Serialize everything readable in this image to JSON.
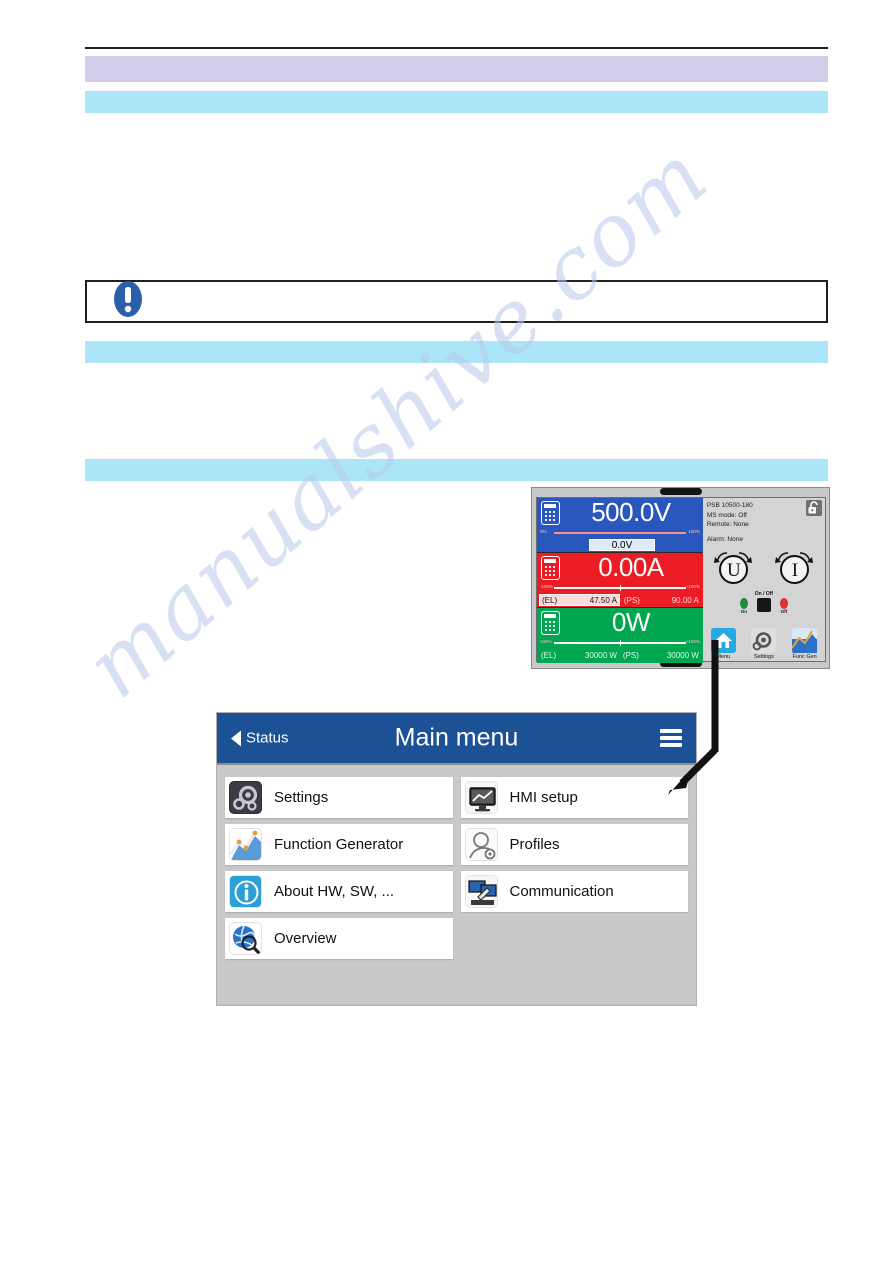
{
  "document": {
    "watermark": "manualshive.com"
  },
  "note": {
    "icon": "info-exclamation-icon",
    "text": ""
  },
  "device_display": {
    "voltage": {
      "icon": "keypad-icon",
      "value": "500.0V",
      "setpoint": "0.0V",
      "scale_min": "0%",
      "scale_max": "100%",
      "color": "#2a57bd"
    },
    "current": {
      "icon": "keypad-icon",
      "value": "0.00A",
      "scale_min": "-100%",
      "scale_max": "+100%",
      "el_label": "(EL)",
      "el_value": "47.50 A",
      "ps_label": "(PS)",
      "ps_value": "90.00 A",
      "color": "#ec1c24"
    },
    "power": {
      "icon": "keypad-icon",
      "value": "0W",
      "scale_min": "100%",
      "scale_max": "+100%",
      "el_label": "(EL)",
      "el_value": "30000 W",
      "ps_label": "(PS)",
      "ps_value": "30000 W",
      "color": "#00a650"
    },
    "status": {
      "model": "PSB 10500-180",
      "ms_mode": "MS mode: Off",
      "remote": "Remote: None",
      "alarm": "Alarm: None",
      "lock_icon": "unlocked-padlock-icon"
    },
    "knobs": [
      {
        "name": "voltage-knob",
        "label": "U"
      },
      {
        "name": "current-knob",
        "label": "I"
      }
    ],
    "power_button": {
      "label": "On / Off",
      "on_label": "On",
      "off_label": "Off"
    },
    "softkeys": [
      {
        "name": "menu",
        "label": "Menu",
        "icon": "home-icon",
        "active": true
      },
      {
        "name": "settings",
        "label": "Settings",
        "icon": "gear-icon",
        "active": false
      },
      {
        "name": "func-gen",
        "label": "Func Gen",
        "icon": "chart-icon",
        "active": false
      }
    ]
  },
  "main_menu": {
    "back_label": "Status",
    "title": "Main menu",
    "menu_icon": "hamburger-icon",
    "left_items": [
      {
        "label": "Settings",
        "icon": "gear-icon"
      },
      {
        "label": "Function Generator",
        "icon": "chart-icon"
      },
      {
        "label": "About HW, SW, ...",
        "icon": "info-icon"
      },
      {
        "label": "Overview",
        "icon": "globe-magnifier-icon"
      }
    ],
    "right_items": [
      {
        "label": "HMI setup",
        "icon": "monitor-icon"
      },
      {
        "label": "Profiles",
        "icon": "person-gear-icon"
      },
      {
        "label": "Communication",
        "icon": "monitors-wrench-icon"
      }
    ]
  },
  "colors": {
    "title_bar": "#1c5196",
    "lavender_bar": "#d2cde8",
    "cyan_bar": "#abe6f8",
    "voltage": "#2a57bd",
    "current": "#ec1c24",
    "power": "#00a650",
    "accent_blue": "#26a9e0"
  }
}
